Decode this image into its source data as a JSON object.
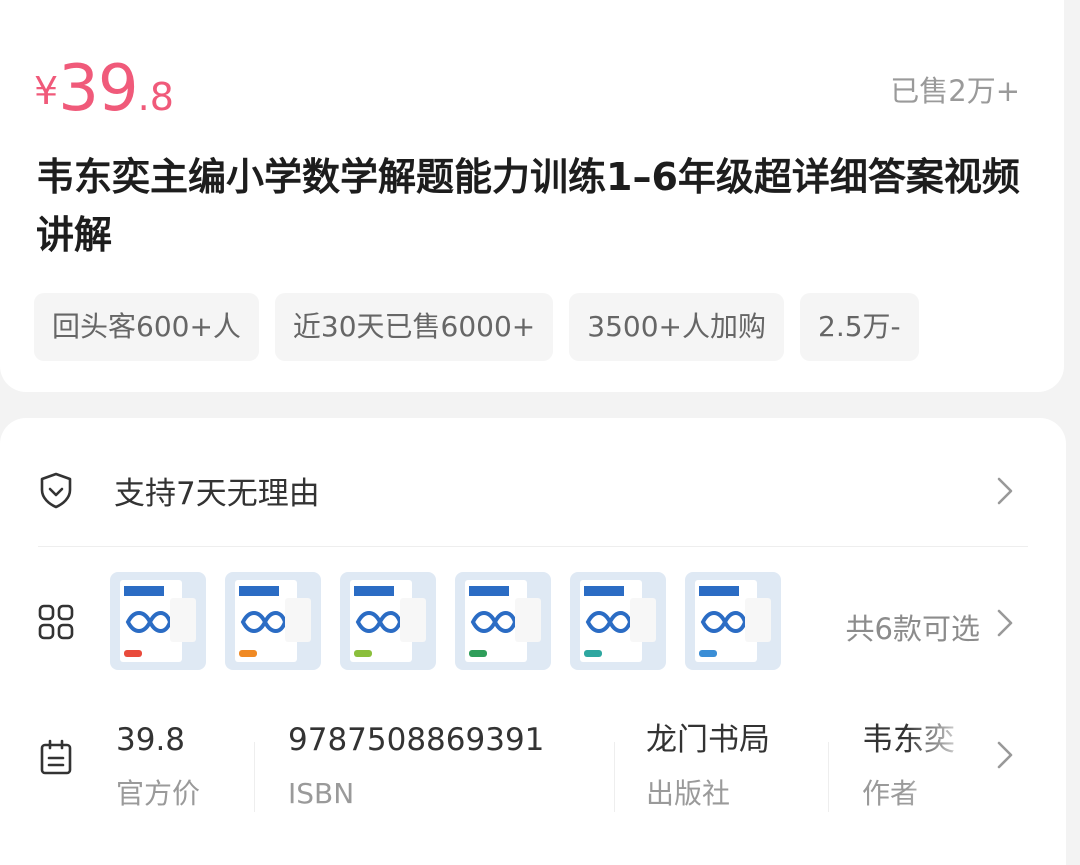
{
  "price": {
    "currency": "¥",
    "integer": "39",
    "decimal": ".8"
  },
  "sold": "已售2万+",
  "title": "韦东奕主编小学数学解题能力训练1–6年级超详细答案视频讲解",
  "tags": [
    "回头客600+人",
    "近30天已售6000+",
    "3500+人加购",
    "2.5万-"
  ],
  "guarantee": {
    "text": "支持7天无理由"
  },
  "variants": {
    "count_text": "共6款可选",
    "thumbs": [
      {
        "accent": "#e94b3c"
      },
      {
        "accent": "#f08a24"
      },
      {
        "accent": "#8bbf3c"
      },
      {
        "accent": "#2f9e5a"
      },
      {
        "accent": "#2ea7a0"
      },
      {
        "accent": "#3b8ed6"
      }
    ]
  },
  "info": [
    {
      "value": "39.8",
      "label": "官方价"
    },
    {
      "value": "9787508869391",
      "label": "ISBN"
    },
    {
      "value": "龙门书局",
      "label": "出版社"
    },
    {
      "value": "韦东奕",
      "label": "作者"
    }
  ],
  "colors": {
    "price": "#f05a7a",
    "background": "#f3f3f3"
  }
}
